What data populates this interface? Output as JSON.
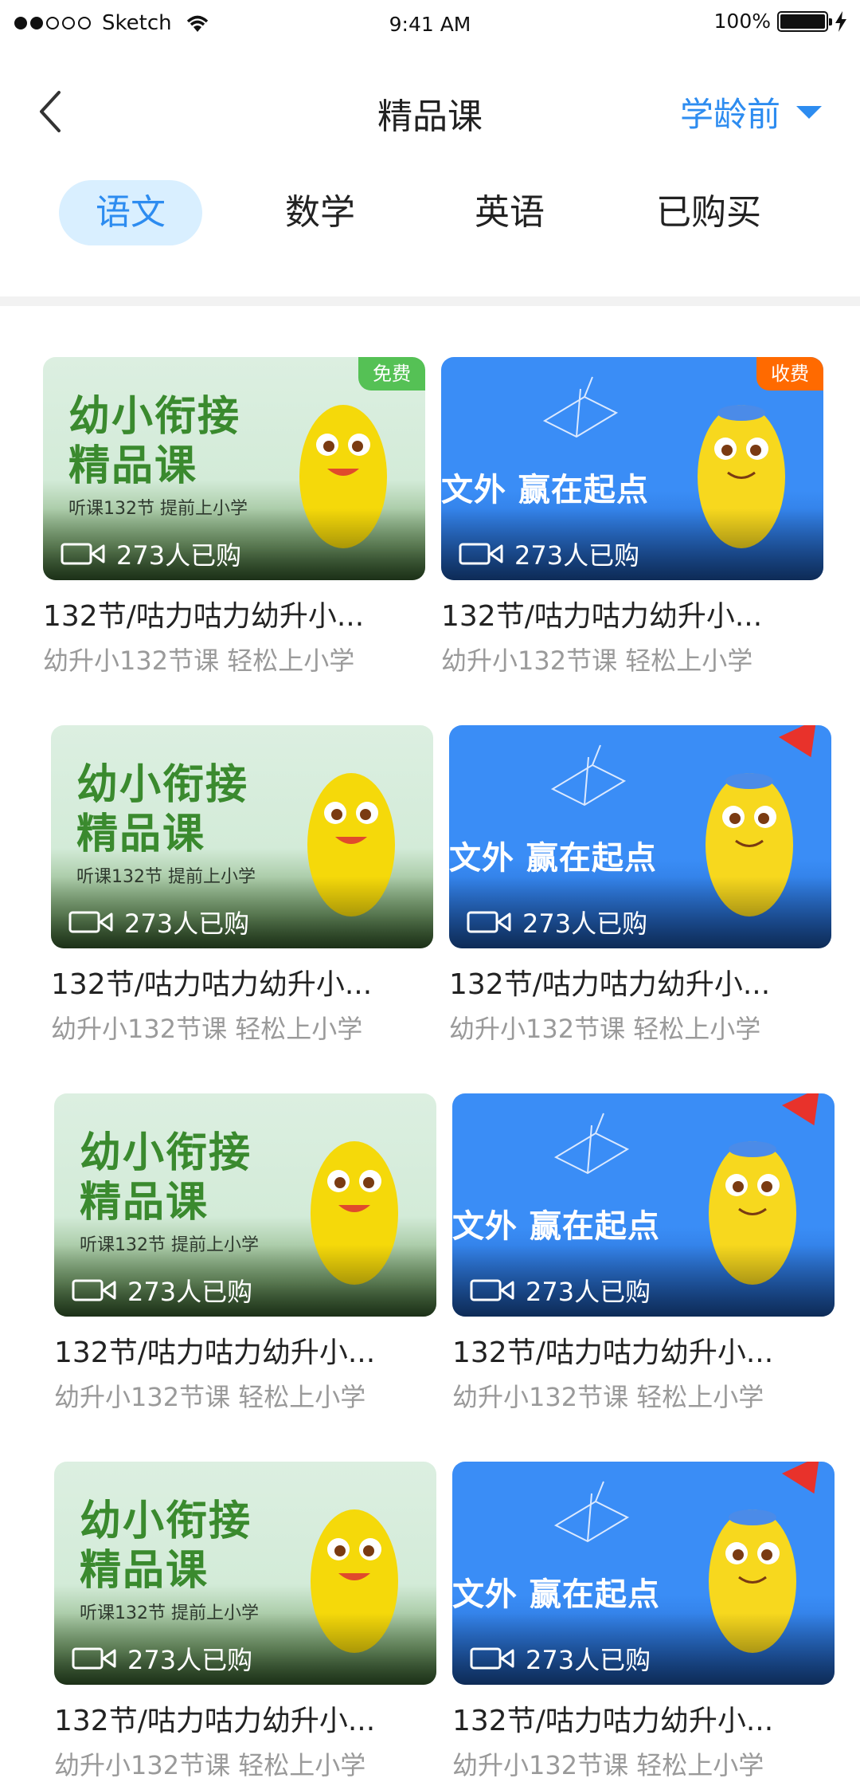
{
  "status_bar": {
    "carrier": "Sketch",
    "time": "9:41 AM",
    "battery": "100%"
  },
  "header": {
    "title": "精品课",
    "grade_select": "学龄前"
  },
  "tabs": [
    "语文",
    "数学",
    "英语",
    "已购买"
  ],
  "active_tab": 0,
  "banners": {
    "green_big_1": "幼小衔接",
    "green_big_2": "精品课",
    "green_small": "听课132节 提前上小学",
    "blue_text": "文外 赢在起点"
  },
  "badges": {
    "free": "免费",
    "paid": "收费"
  },
  "courses": [
    {
      "buyers": "273人已购",
      "title": "132节/咕力咕力幼升小...",
      "subtitle": "幼升小132节课 轻松上小学"
    },
    {
      "buyers": "273人已购",
      "title": "132节/咕力咕力幼升小...",
      "subtitle": "幼升小132节课 轻松上小学"
    },
    {
      "buyers": "273人已购",
      "title": "132节/咕力咕力幼升小...",
      "subtitle": "幼升小132节课 轻松上小学"
    },
    {
      "buyers": "273人已购",
      "title": "132节/咕力咕力幼升小...",
      "subtitle": "幼升小132节课 轻松上小学"
    },
    {
      "buyers": "273人已购",
      "title": "132节/咕力咕力幼升小...",
      "subtitle": "幼升小132节课 轻松上小学"
    },
    {
      "buyers": "273人已购",
      "title": "132节/咕力咕力幼升小...",
      "subtitle": "幼升小132节课 轻松上小学"
    },
    {
      "buyers": "273人已购",
      "title": "132节/咕力咕力幼升小...",
      "subtitle": "幼升小132节课 轻松上小学"
    },
    {
      "buyers": "273人已购",
      "title": "132节/咕力咕力幼升小...",
      "subtitle": "幼升小132节课 轻松上小学"
    }
  ],
  "colors": {
    "accent": "#2d8cf0",
    "tab_active_bg": "#d9efff",
    "free_badge": "#55c155",
    "paid_badge": "#ff6a00"
  }
}
